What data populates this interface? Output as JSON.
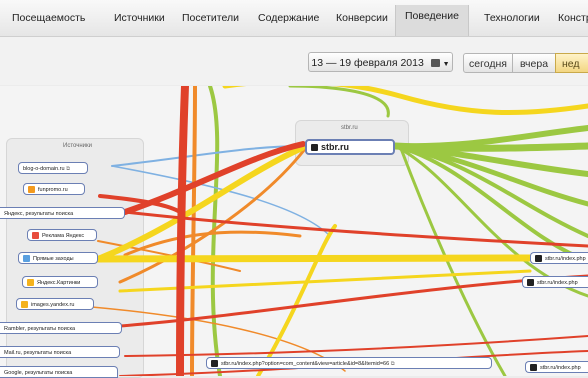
{
  "nav": {
    "tabs": [
      "Посещаемость",
      "Источники",
      "Посетители",
      "Содержание",
      "Конверсии",
      "Поведение",
      "Технологии",
      "Констр"
    ],
    "active": "Поведение"
  },
  "toolbar": {
    "date_range": "13 — 19 февраля 2013",
    "periods": [
      "сегодня",
      "вчера",
      "нед"
    ],
    "selected_period": "нед"
  },
  "sources_panel": {
    "title": "Источники",
    "items": [
      {
        "label": "blog-o-domain.ru",
        "icon": "external-link-icon"
      },
      {
        "label": "funpromo.ru",
        "icon": "site-favicon"
      },
      {
        "label": "Яндекс, результаты поиска",
        "icon": "none"
      },
      {
        "label": "Реклама Яндекс",
        "icon": "yandex-direct-icon"
      },
      {
        "label": "Прямые заходы",
        "icon": "direct-visit-icon"
      },
      {
        "label": "Яндекс.Картинки",
        "icon": "yandex-images-icon"
      },
      {
        "label": "images.yandex.ru",
        "icon": "yandex-images-icon"
      },
      {
        "label": "Rambler, результаты поиска",
        "icon": "none"
      },
      {
        "label": "Mail.ru, результаты поиска",
        "icon": "none"
      },
      {
        "label": "Google, результаты поиска",
        "icon": "none"
      }
    ]
  },
  "site_panel": {
    "title": "stbr.ru",
    "node": "stbr.ru"
  },
  "pages": [
    "stbr.ru/index.php",
    "stbr.ru/index.php",
    "stbr.ru/index.php",
    "stbr.ru/index.php?option=com_content&view=article&id=8&Itemid=66"
  ],
  "colors": {
    "red": "#e0412a",
    "orange": "#f08a2a",
    "yellow": "#f5d61e",
    "green": "#9cc842",
    "blue": "#7fb1e2",
    "node_border": "#6b7fb4"
  }
}
